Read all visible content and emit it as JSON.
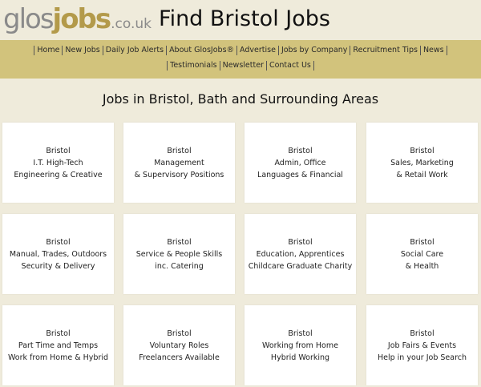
{
  "logo": {
    "part1": "glos",
    "part2": "jobs",
    "part3": ".co.uk"
  },
  "header": {
    "title": "Find Bristol Jobs"
  },
  "nav": {
    "row1": [
      "Home",
      "New Jobs",
      "Daily Job Alerts",
      "About GlosJobs®",
      "Advertise",
      "Jobs by Company",
      "Recruitment Tips",
      "News"
    ],
    "row2": [
      "Testimonials",
      "Newsletter",
      "Contact Us"
    ]
  },
  "main": {
    "heading": "Jobs in Bristol, Bath and Surrounding Areas",
    "cards": [
      {
        "lines": [
          "Bristol",
          "I.T. High-Tech",
          "Engineering & Creative"
        ]
      },
      {
        "lines": [
          "Bristol",
          "Management",
          "& Supervisory Positions"
        ]
      },
      {
        "lines": [
          "Bristol",
          "Admin, Office",
          "Languages & Financial"
        ]
      },
      {
        "lines": [
          "Bristol",
          "Sales, Marketing",
          "& Retail Work"
        ]
      },
      {
        "lines": [
          "Bristol",
          "Manual, Trades, Outdoors",
          "Security & Delivery"
        ]
      },
      {
        "lines": [
          "Bristol",
          "Service & People Skills",
          "inc. Catering"
        ]
      },
      {
        "lines": [
          "Bristol",
          "Education, Apprentices",
          "Childcare Graduate Charity"
        ]
      },
      {
        "lines": [
          "Bristol",
          "Social Care",
          "& Health"
        ]
      },
      {
        "lines": [
          "Bristol",
          "Part Time and Temps",
          "Work from Home & Hybrid"
        ]
      },
      {
        "lines": [
          "Bristol",
          "Voluntary Roles",
          "Freelancers Available"
        ]
      },
      {
        "lines": [
          "Bristol",
          "Working from Home",
          "Hybrid Working"
        ]
      },
      {
        "lines": [
          "Bristol",
          "Job Fairs & Events",
          "Help in your Job Search"
        ]
      }
    ]
  }
}
